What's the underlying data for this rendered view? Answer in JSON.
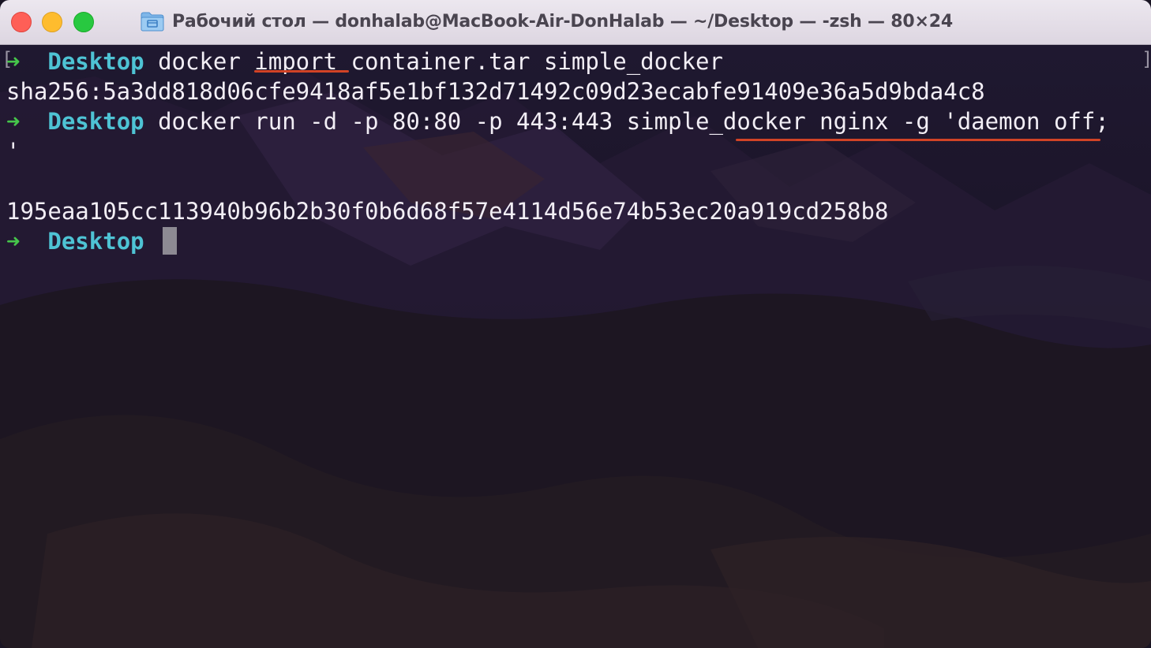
{
  "window": {
    "title": "Рабочий стол — donhalab@MacBook-Air-DonHalab — ~/Desktop — -zsh — 80×24",
    "folder_icon": "folder-icon"
  },
  "terminal": {
    "prompt_symbol": "➜",
    "prompt_dir": "Desktop",
    "lines": [
      {
        "kind": "command",
        "text": "docker import container.tar simple_docker"
      },
      {
        "kind": "output",
        "text": "sha256:5a3dd818d06cfe9418af5e1bf132d71492c09d23ecabfe91409e36a5d9bda4c8"
      },
      {
        "kind": "command",
        "text": "docker run -d -p 80:80 -p 443:443 simple_docker nginx -g 'daemon off;"
      },
      {
        "kind": "output",
        "text": "'"
      },
      {
        "kind": "output",
        "text": "195eaa105cc113940b96b2b30f0b6d68f57e4114d56e74b53ec20a919cd258b8"
      }
    ],
    "colors": {
      "prompt_arrow": "#46c64b",
      "prompt_dir": "#4ec3d4",
      "annotation_underline": "#d14326",
      "text": "#f2eef5"
    }
  }
}
